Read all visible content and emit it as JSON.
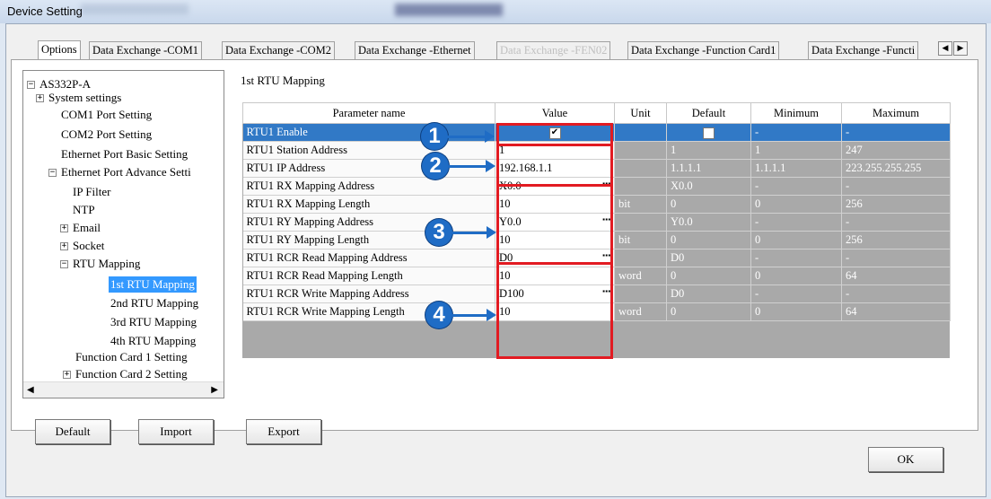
{
  "window": {
    "title": "Device Setting"
  },
  "tabs": [
    {
      "label": "Options",
      "state": "active"
    },
    {
      "label": "Data Exchange -COM1",
      "state": "normal"
    },
    {
      "label": "Data Exchange -COM2",
      "state": "normal"
    },
    {
      "label": "Data Exchange -Ethernet",
      "state": "normal"
    },
    {
      "label": "Data Exchange -FEN02",
      "state": "disabled"
    },
    {
      "label": "Data Exchange -Function Card1",
      "state": "normal"
    },
    {
      "label": "Data Exchange -Functi",
      "state": "normal"
    }
  ],
  "tree": {
    "nodes": [
      {
        "label": "AS332P-A",
        "expander": "−"
      },
      {
        "label": "System settings",
        "expander": "+"
      },
      {
        "label": "COM1 Port Setting",
        "expander": ""
      },
      {
        "label": "COM2 Port Setting",
        "expander": ""
      },
      {
        "label": "Ethernet Port Basic Setting",
        "expander": ""
      },
      {
        "label": "Ethernet Port Advance Setti",
        "expander": "−"
      },
      {
        "label": "IP Filter",
        "expander": ""
      },
      {
        "label": "NTP",
        "expander": ""
      },
      {
        "label": "Email",
        "expander": "+"
      },
      {
        "label": "Socket",
        "expander": "+"
      },
      {
        "label": "RTU Mapping",
        "expander": "−"
      },
      {
        "label": "1st RTU Mapping",
        "expander": "",
        "selected": true
      },
      {
        "label": "2nd RTU Mapping",
        "expander": ""
      },
      {
        "label": "3rd RTU Mapping",
        "expander": ""
      },
      {
        "label": "4th RTU Mapping",
        "expander": ""
      },
      {
        "label": "Function Card 1 Setting",
        "expander": ""
      },
      {
        "label": "Function Card 2 Setting",
        "expander": "+"
      }
    ]
  },
  "section_title": "1st RTU Mapping",
  "grid": {
    "headers": [
      "Parameter name",
      "Value",
      "Unit",
      "Default",
      "Minimum",
      "Maximum"
    ],
    "rows": [
      {
        "name": "RTU1 Enable",
        "value": "",
        "checked": true,
        "unit": "",
        "default": "",
        "default_checked": false,
        "min": "-",
        "max": "-",
        "selected": true,
        "dots": false
      },
      {
        "name": "RTU1 Station Address",
        "value": "1",
        "unit": "",
        "default": "1",
        "min": "1",
        "max": "247",
        "dots": false
      },
      {
        "name": "RTU1 IP Address",
        "value": "192.168.1.1",
        "unit": "",
        "default": "1.1.1.1",
        "min": "1.1.1.1",
        "max": "223.255.255.255",
        "dots": false
      },
      {
        "name": "RTU1 RX Mapping Address",
        "value": "X0.0",
        "unit": "",
        "default": "X0.0",
        "min": "-",
        "max": "-",
        "dots": true
      },
      {
        "name": "RTU1 RX Mapping Length",
        "value": "10",
        "unit": "bit",
        "default": "0",
        "min": "0",
        "max": "256",
        "dots": false
      },
      {
        "name": "RTU1 RY Mapping Address",
        "value": "Y0.0",
        "unit": "",
        "default": "Y0.0",
        "min": "-",
        "max": "-",
        "dots": true
      },
      {
        "name": "RTU1 RY Mapping Length",
        "value": "10",
        "unit": "bit",
        "default": "0",
        "min": "0",
        "max": "256",
        "dots": false
      },
      {
        "name": "RTU1 RCR Read Mapping Address",
        "value": "D0",
        "unit": "",
        "default": "D0",
        "min": "-",
        "max": "-",
        "dots": true
      },
      {
        "name": "RTU1 RCR Read Mapping Length",
        "value": "10",
        "unit": "word",
        "default": "0",
        "min": "0",
        "max": "64",
        "dots": false
      },
      {
        "name": "RTU1 RCR Write Mapping Address",
        "value": "D100",
        "unit": "",
        "default": "D0",
        "min": "-",
        "max": "-",
        "dots": true
      },
      {
        "name": "RTU1 RCR Write Mapping Length",
        "value": "10",
        "unit": "word",
        "default": "0",
        "min": "0",
        "max": "64",
        "dots": false
      }
    ]
  },
  "callouts": [
    "1",
    "2",
    "3",
    "4"
  ],
  "buttons": {
    "default": "Default",
    "import": "Import",
    "export": "Export",
    "ok": "OK"
  },
  "colors": {
    "selection": "#3179c6",
    "callout": "#1f6cc5",
    "highlight_box": "#e21b22"
  }
}
